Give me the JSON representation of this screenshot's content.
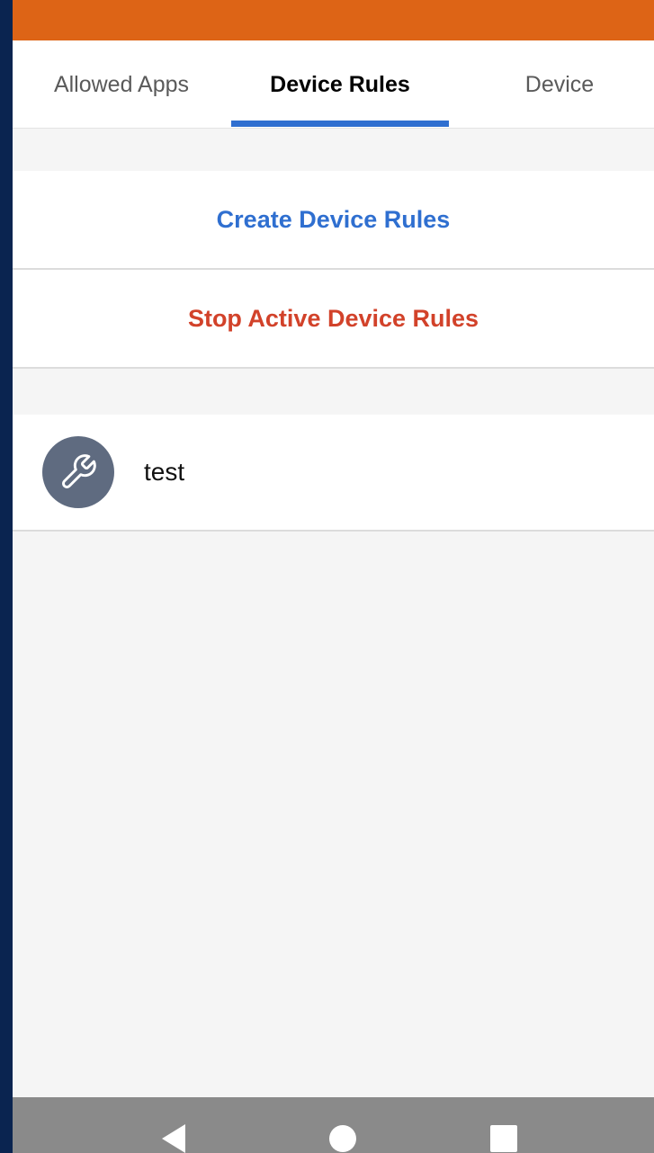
{
  "tabs": [
    {
      "label": "Allowed Apps"
    },
    {
      "label": "Device Rules",
      "active": true
    },
    {
      "label": "Device"
    }
  ],
  "actions": {
    "create_label": "Create Device Rules",
    "stop_label": "Stop Active Device Rules"
  },
  "rules": [
    {
      "name": "test",
      "icon": "wrench-icon"
    }
  ],
  "nav": {
    "back_icon": "back-icon",
    "home_icon": "home-icon",
    "recent_icon": "recent-apps-icon"
  },
  "colors": {
    "top_bar": "#dd6416",
    "accent": "#2f6fd0",
    "danger": "#d2422a",
    "avatar": "#5f6b80",
    "frame": "#0a2450"
  }
}
